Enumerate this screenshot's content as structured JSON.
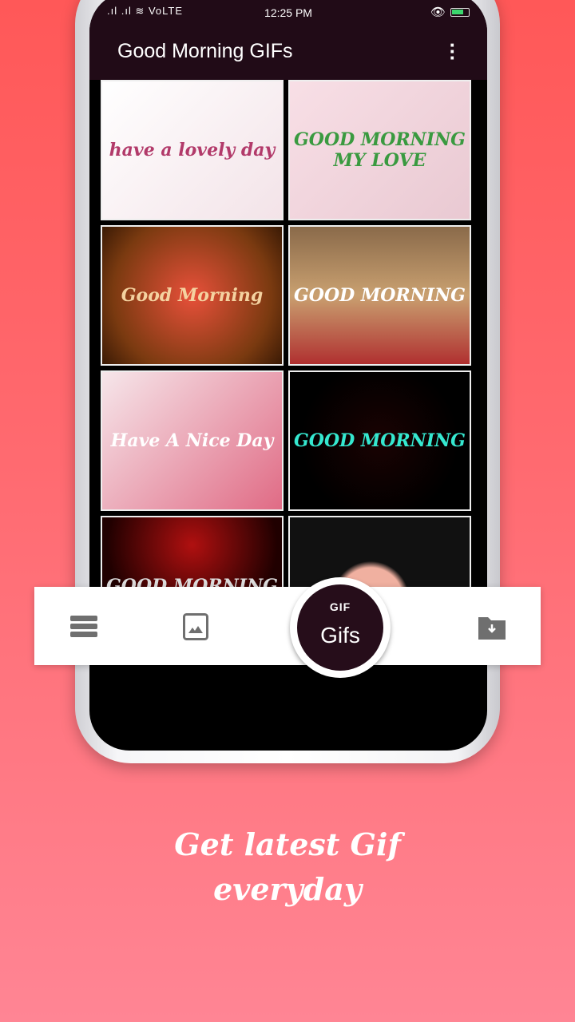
{
  "status_bar": {
    "signal": ".ıl .ıl ≋ VoLTE",
    "time": "12:25 PM",
    "eye_icon": "👁"
  },
  "app_bar": {
    "title": "Good Morning GIFs",
    "menu_icon": "more-vert"
  },
  "tiles": [
    {
      "caption": "have a lovely day",
      "bg": "linear-gradient(135deg,#fff,#f3e3e8)",
      "color": "#b23a6a"
    },
    {
      "caption": "GOOD MORNING MY LOVE",
      "bg": "linear-gradient(135deg,#f8dfe6,#e9c9d2)",
      "color": "#3a9a40"
    },
    {
      "caption": "Good Morning",
      "bg": "radial-gradient(circle,#e8503a,#7a3a10 70%,#3a1a05)",
      "color": "#f4d2a0"
    },
    {
      "caption": "GOOD MORNING",
      "bg": "linear-gradient(180deg,#8a6a4a,#c9a070 50%,#b03030)",
      "color": "#fff"
    },
    {
      "caption": "Have A Nice Day",
      "bg": "linear-gradient(135deg,#f6e6ea,#e06b85)",
      "color": "#fff"
    },
    {
      "caption": "GOOD MORNING",
      "bg": "radial-gradient(circle,#1a0202,#000 70%)",
      "color": "#35e8d0"
    },
    {
      "caption": "GOOD MORNING",
      "bg": "radial-gradient(circle at 50% 20%,#b01010,#200000 60%)",
      "color": "#ddd"
    },
    {
      "caption": "",
      "bg": "radial-gradient(circle at 45% 60%,#f0b0a0 0 25%,#111 30%)",
      "color": "#fff"
    }
  ],
  "bottom_nav": {
    "gif_badge": "GIF",
    "gifs_label": "Gifs",
    "icons": [
      "menu-icon",
      "image-icon",
      "gif-icon",
      "download-folder-icon"
    ]
  },
  "tagline": {
    "line1": "Get latest Gif",
    "line2": "everyday"
  },
  "colors": {
    "appbar": "#210b17",
    "fab": "#260d1a",
    "bg_top": "#ff5858",
    "bg_bottom": "#ff8594"
  }
}
